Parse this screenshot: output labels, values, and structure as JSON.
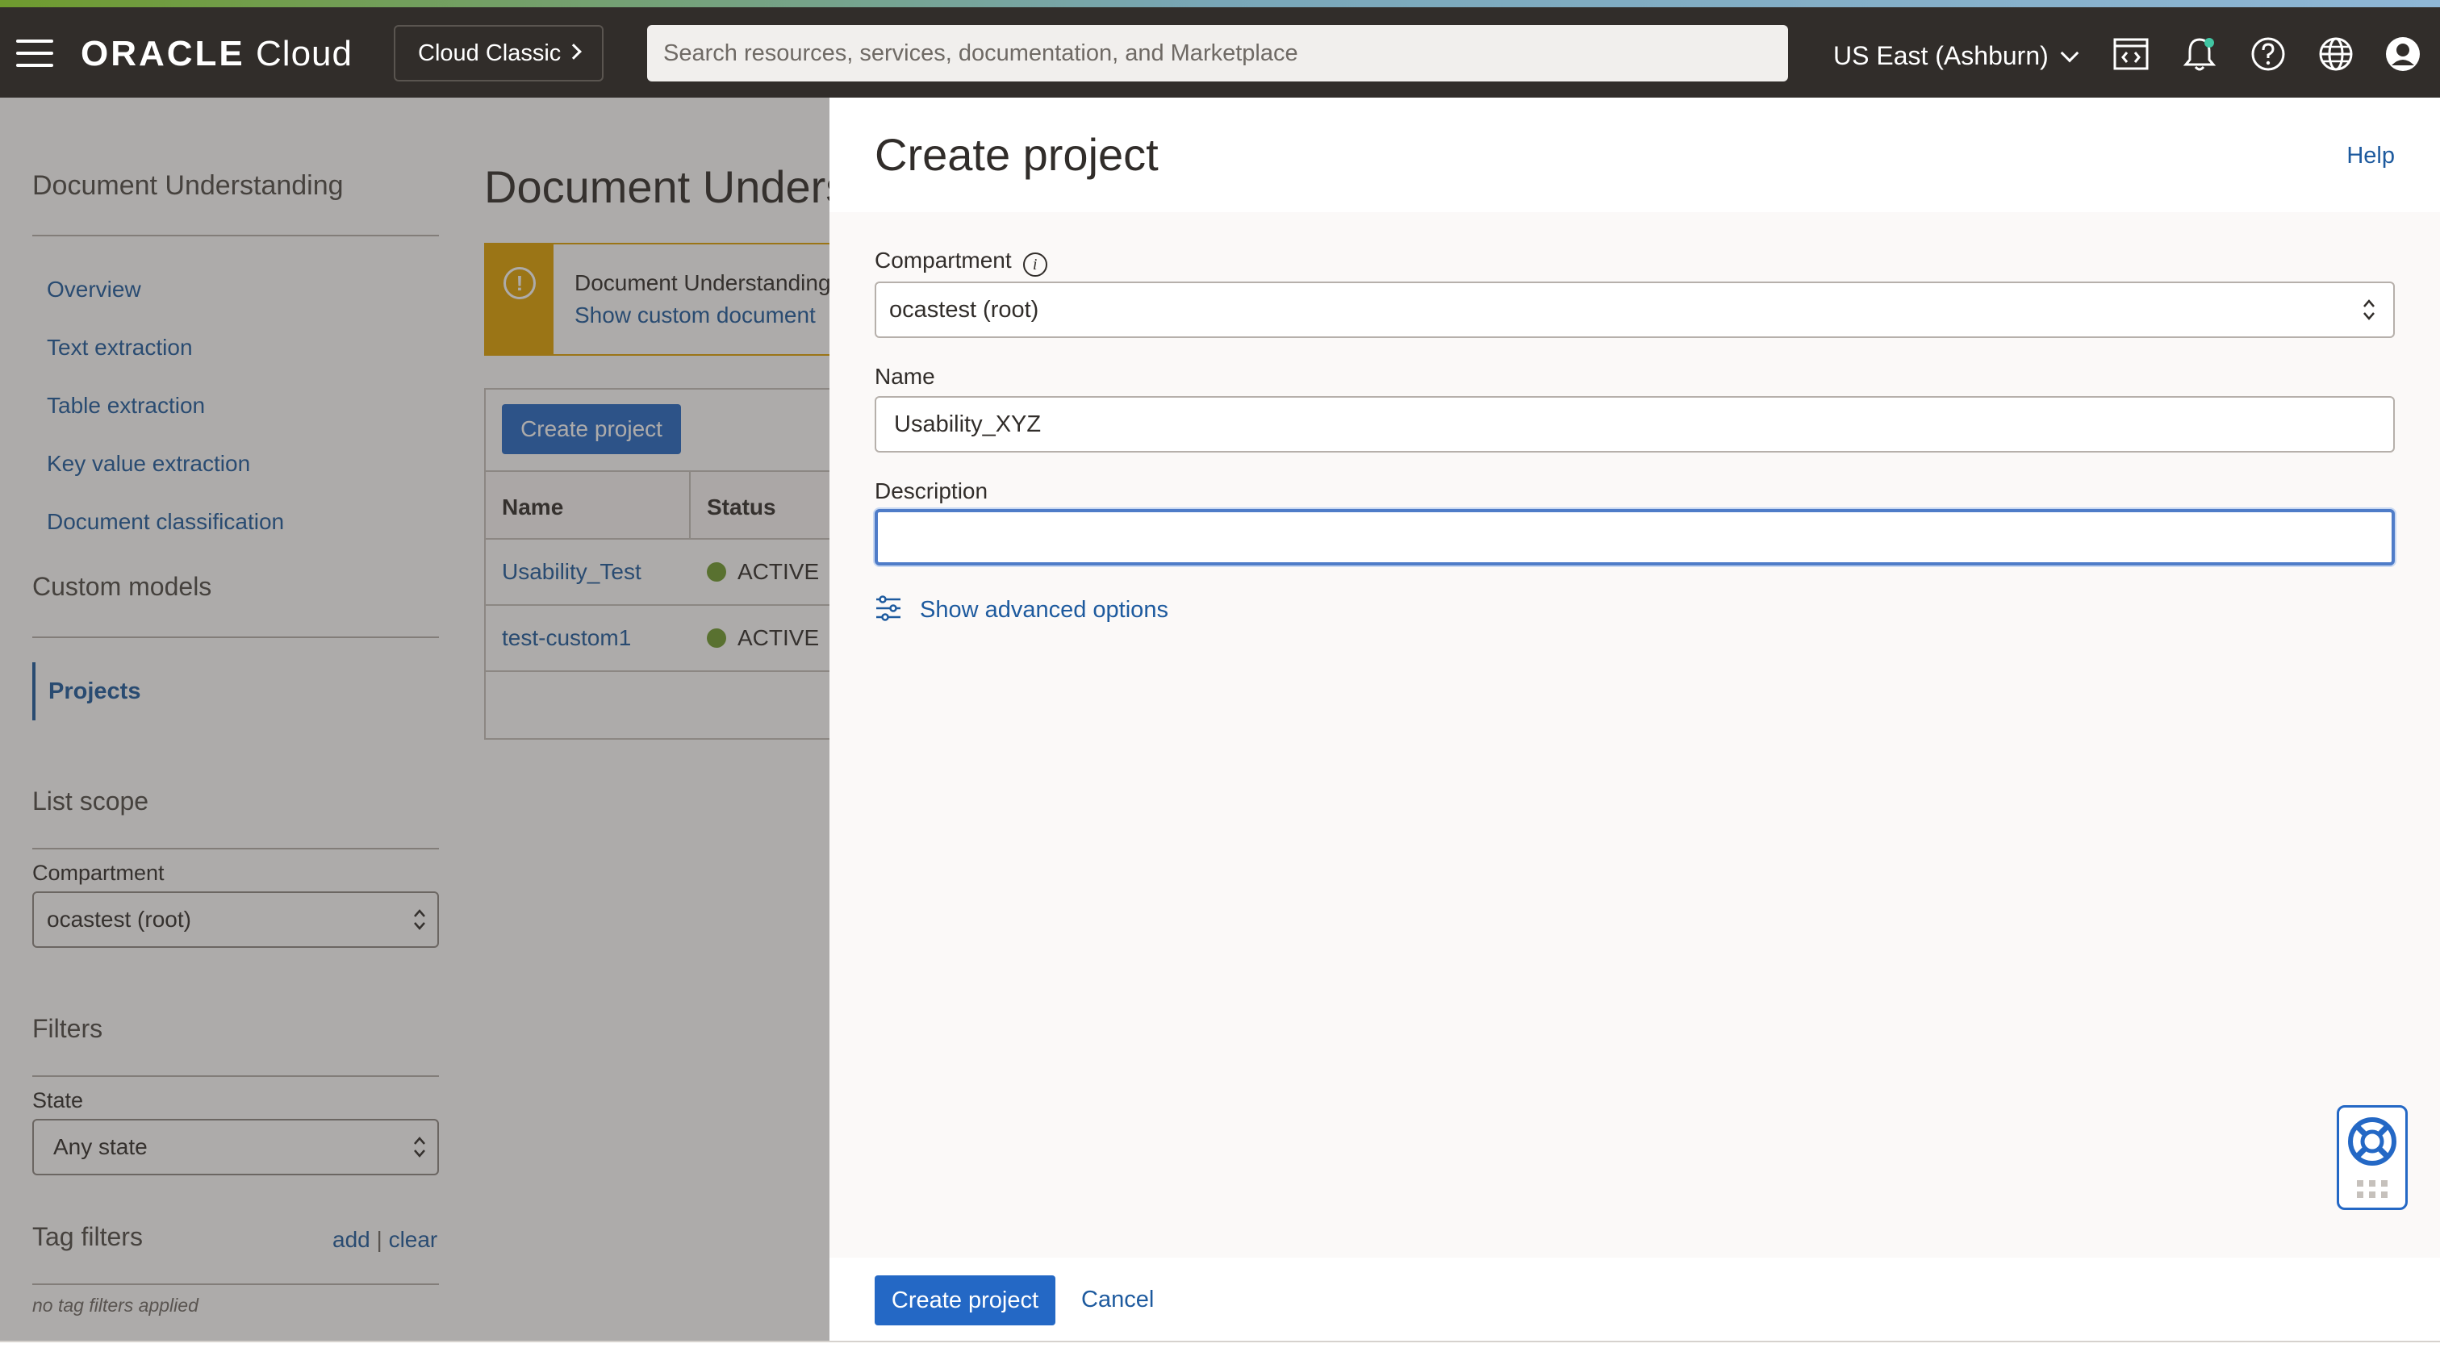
{
  "header": {
    "brand_bold": "ORACLE",
    "brand_light": "Cloud",
    "classic_label": "Cloud Classic",
    "search_placeholder": "Search resources, services, documentation, and Marketplace",
    "region": "US East (Ashburn)",
    "icons": [
      "menu-icon",
      "code-editor-icon",
      "bell-icon",
      "help-icon",
      "globe-icon",
      "user-icon"
    ]
  },
  "sidebar": {
    "title": "Document Understanding",
    "links": [
      "Overview",
      "Text extraction",
      "Table extraction",
      "Key value extraction",
      "Document classification"
    ],
    "custom_models": "Custom models",
    "active_item": "Projects",
    "list_scope": "List scope",
    "compartment_label": "Compartment",
    "compartment_value": "ocastest (root)",
    "filters": "Filters",
    "state_label": "State",
    "state_value": "Any state",
    "tag_filters": "Tag filters",
    "tag_add": "add",
    "tag_sep": "|",
    "tag_clear": "clear",
    "no_tags": "no tag filters applied"
  },
  "main": {
    "title": "Document Understanding",
    "warning_text": "Document Understanding",
    "warning_link": "Show custom document",
    "create_button": "Create project",
    "columns": [
      "Name",
      "Status"
    ],
    "rows": [
      {
        "name": "Usability_Test",
        "status": "ACTIVE"
      },
      {
        "name": "test-custom1",
        "status": "ACTIVE"
      }
    ]
  },
  "panel": {
    "title": "Create project",
    "help": "Help",
    "compartment_label": "Compartment",
    "compartment_value": "ocastest (root)",
    "name_label": "Name",
    "name_value": "Usability_XYZ",
    "description_label": "Description",
    "description_value": "",
    "advanced": "Show advanced options",
    "submit": "Create project",
    "cancel": "Cancel"
  },
  "colors": {
    "header_bg": "#312d2a",
    "link": "#1d5a9e",
    "primary_button": "#2468c5",
    "warning": "#e0a200",
    "active_status": "#6f9b2e"
  }
}
